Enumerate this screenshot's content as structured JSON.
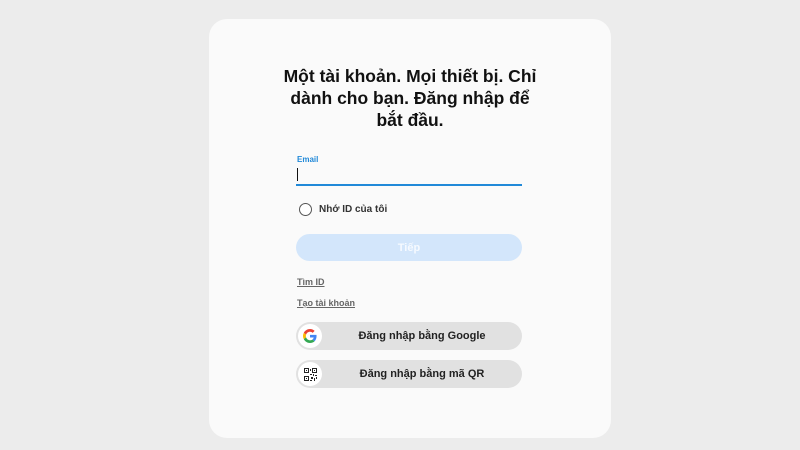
{
  "login": {
    "title_lines": [
      "Một tài khoản. Mọi thiết bị. Chỉ",
      "dành cho bạn. Đăng nhập để",
      "bắt đầu."
    ],
    "email_label": "Email",
    "email_value": "",
    "remember_label": "Nhớ ID của tôi",
    "remember_checked": false,
    "next_label": "Tiếp",
    "find_id_label": "Tìm ID",
    "create_account_label": "Tạo tài khoản",
    "google_label": "Đăng nhập bằng Google",
    "qr_label": "Đăng nhập bằng mã QR",
    "icons": {
      "google": "google-logo-icon",
      "qr": "qr-code-icon"
    }
  },
  "colors": {
    "accent": "#2189d8",
    "next_button_disabled": "#d3e6fb",
    "card_background": "#fafafa",
    "page_background": "#ececec",
    "social_button_background": "#e1e1e1"
  }
}
